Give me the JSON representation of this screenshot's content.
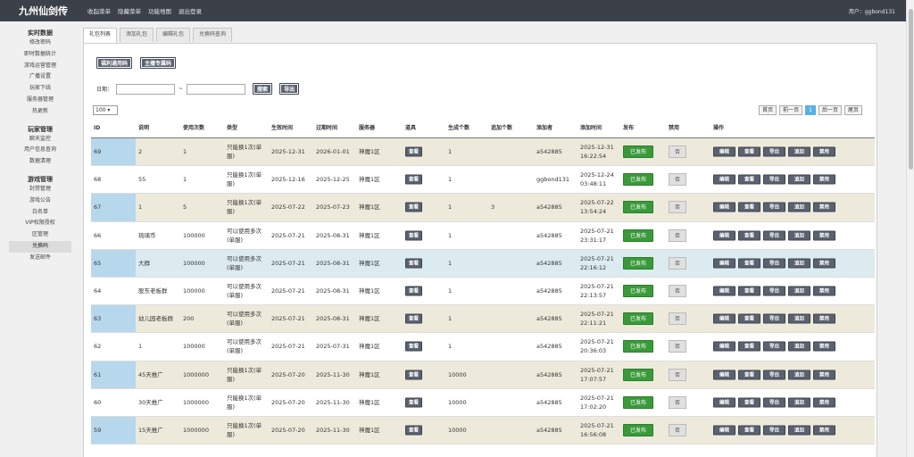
{
  "app": {
    "title": "九州仙剑传",
    "user": "用户：ggbond131"
  },
  "topnav": [
    "收起菜单",
    "隐藏菜单",
    "功能地图",
    "退出登录"
  ],
  "sidebar": [
    {
      "title": "实时数据",
      "items": [
        "修改密码",
        "即时数据统计",
        "游戏运营管理",
        "广播设置",
        "玩家下线",
        "服务器管理",
        "热更新"
      ]
    },
    {
      "title": "玩家管理",
      "items": [
        "聊天监控",
        "用户信息查询",
        "数据清理"
      ]
    },
    {
      "title": "游戏管理",
      "items": [
        "封禁管理",
        "游戏公告",
        "白名单",
        "VIP权限授权",
        "区管理",
        "兑换码",
        "发送邮件"
      ]
    }
  ],
  "active_sidebar": "兑换码",
  "tabs": [
    "礼包列表",
    "添加礼包",
    "编辑礼包",
    "兑换码查询"
  ],
  "actions": {
    "gen_code": "福利通用码",
    "anchor_code": "主播专属码",
    "date_label": "日期：",
    "tilde": "~",
    "search": "搜索",
    "export": "导出"
  },
  "page_size": "100 ▾",
  "pager": [
    "首页",
    "前一页",
    "1",
    "后一页",
    "尾页"
  ],
  "columns": [
    "ID",
    "说明",
    "使用次数",
    "类型",
    "生效时间",
    "过期时间",
    "服务器",
    "道具",
    "生成个数",
    "追加个数",
    "添加者",
    "添加时间",
    "发布",
    "禁用",
    "操作"
  ],
  "view_label": "查看",
  "publish_label": "已发布",
  "disable_label": "否",
  "ops": [
    "编辑",
    "查看",
    "导出",
    "追加",
    "禁用"
  ],
  "rows": [
    {
      "id": "69",
      "desc": "2",
      "uses": "1",
      "type": "只能换1次(单服)",
      "start": "2025-12-31",
      "end": "2026-01-01",
      "server": "神魔1区",
      "gen": "1",
      "add": "",
      "by": "a542885",
      "time": "2025-12-31 16:22:54"
    },
    {
      "id": "68",
      "desc": "55",
      "uses": "1",
      "type": "只能换1次(单服)",
      "start": "2025-12-16",
      "end": "2025-12-25",
      "server": "神魔1区",
      "gen": "1",
      "add": "",
      "by": "ggbond131",
      "time": "2025-12-24 03:48:11"
    },
    {
      "id": "67",
      "desc": "1",
      "uses": "5",
      "type": "只能换1次(单服)",
      "start": "2025-07-22",
      "end": "2025-07-23",
      "server": "神魔1区",
      "gen": "1",
      "add": "3",
      "by": "a542885",
      "time": "2025-07-22 13:54:24"
    },
    {
      "id": "66",
      "desc": "琉璃币",
      "uses": "100000",
      "type": "可以使用多次(单服)",
      "start": "2025-07-21",
      "end": "2025-08-31",
      "server": "神魔1区",
      "gen": "1",
      "add": "",
      "by": "a542885",
      "time": "2025-07-21 23:31:17"
    },
    {
      "id": "65",
      "desc": "大群",
      "uses": "100000",
      "type": "可以使用多次(单服)",
      "start": "2025-07-21",
      "end": "2025-08-31",
      "server": "神魔1区",
      "gen": "1",
      "add": "",
      "by": "a542885",
      "time": "2025-07-21 22:16:12"
    },
    {
      "id": "64",
      "desc": "股东老板群",
      "uses": "100000",
      "type": "可以使用多次(单服)",
      "start": "2025-07-21",
      "end": "2025-08-31",
      "server": "神魔1区",
      "gen": "1",
      "add": "",
      "by": "a542885",
      "time": "2025-07-21 22:13:57"
    },
    {
      "id": "63",
      "desc": "幼儿园老板群",
      "uses": "200",
      "type": "可以使用多次(单服)",
      "start": "2025-07-21",
      "end": "2025-08-31",
      "server": "神魔1区",
      "gen": "1",
      "add": "",
      "by": "a542885",
      "time": "2025-07-21 22:11:21"
    },
    {
      "id": "62",
      "desc": "1",
      "uses": "100000",
      "type": "可以使用多次(单服)",
      "start": "2025-07-21",
      "end": "2025-07-31",
      "server": "神魔1区",
      "gen": "1",
      "add": "",
      "by": "a542885",
      "time": "2025-07-21 20:36:03"
    },
    {
      "id": "61",
      "desc": "45天推广",
      "uses": "1000000",
      "type": "只能换1次(单服)",
      "start": "2025-07-20",
      "end": "2025-11-30",
      "server": "神魔1区",
      "gen": "10000",
      "add": "",
      "by": "a542885",
      "time": "2025-07-21 17:07:57"
    },
    {
      "id": "60",
      "desc": "30天推广",
      "uses": "1000000",
      "type": "只能换1次(单服)",
      "start": "2025-07-20",
      "end": "2025-11-30",
      "server": "神魔1区",
      "gen": "10000",
      "add": "",
      "by": "a542885",
      "time": "2025-07-21 17:02:20"
    },
    {
      "id": "59",
      "desc": "15天推广",
      "uses": "1000000",
      "type": "只能换1次(单服)",
      "start": "2025-07-20",
      "end": "2025-11-30",
      "server": "神魔1区",
      "gen": "10000",
      "add": "",
      "by": "a542885",
      "time": "2025-07-21 16:56:08"
    }
  ]
}
